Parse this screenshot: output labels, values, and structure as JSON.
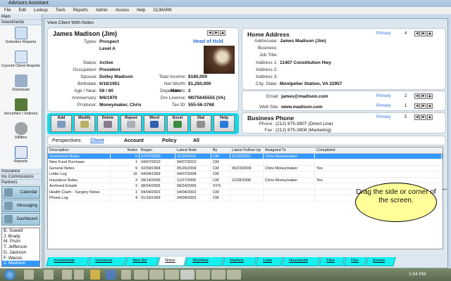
{
  "app": {
    "title": "Advisors Assistant"
  },
  "menu": [
    "File",
    "Edit",
    "Lookup",
    "Tools",
    "Reports",
    "Admin",
    "Access",
    "Help",
    "CLIMARK"
  ],
  "sidebar": {
    "main": "Main",
    "investments": "Investments",
    "icons": [
      {
        "label": "Selection Reports",
        "icon": "selection-reports-icon"
      },
      {
        "label": "Current Client Reports",
        "icon": "client-reports-icon"
      },
      {
        "label": "Download",
        "icon": "download-icon"
      },
      {
        "label": "Securities / Indexes",
        "icon": "securities-icon"
      },
      {
        "label": "Utilities",
        "icon": "wrench-icon"
      },
      {
        "label": "Reports",
        "icon": "reports-icon"
      }
    ],
    "insurance": "Insurance",
    "ins_commissions": "Ins Commissions",
    "partners": "Partners",
    "big_buttons": [
      "Calendar",
      "Messaging",
      "Dashboard"
    ],
    "partner_list": [
      "B. Sowell",
      "J. Brady",
      "M. Pozo",
      "T. Jefferson",
      "D. Jackson",
      "F. Wacos",
      "J. Madison"
    ],
    "selected_partner": "J. Madison"
  },
  "window": {
    "title": "View Client With Notes"
  },
  "client": {
    "name": "James Madison (Jim)",
    "head_of_hsld": "Head of Hsld",
    "types_label": "Types:",
    "types": "Prospect",
    "level": "Level A",
    "fields_left": [
      {
        "label": "Status:",
        "value": "Active"
      },
      {
        "label": "Occupation:",
        "value": "President"
      },
      {
        "label": "Spouse:",
        "value": "Dolley Madison"
      },
      {
        "label": "Birthdate:",
        "value": "6/16/1951"
      },
      {
        "label": "Age / Near:",
        "value": "59 / 60"
      },
      {
        "label": "Anniversary:",
        "value": "9/6/1970"
      },
      {
        "label": "Producer:",
        "value": "Moneymaker, Chris"
      }
    ],
    "gender": "Male",
    "fields_right": [
      {
        "label": "Total Income:",
        "value": "$180,000"
      },
      {
        "label": "Net Worth:",
        "value": "$1,250,000"
      },
      {
        "label": "Dependents:",
        "value": "2"
      },
      {
        "label": "Drv License:",
        "value": "M075645555 (VA)"
      },
      {
        "label": "Tax ID:",
        "value": "555-56-3768"
      }
    ]
  },
  "address": {
    "title": "Home Address",
    "primary": "Primary",
    "count": "4",
    "fields": [
      {
        "label": "Addressee:",
        "value": "James Madison (Jim)"
      },
      {
        "label": "Business:",
        "value": ""
      },
      {
        "label": "Job Title:",
        "value": ""
      },
      {
        "label": "Address 1:",
        "value": "11407 Constitution Hwy"
      },
      {
        "label": "Address 2:",
        "value": ""
      },
      {
        "label": "Address 3:",
        "value": ""
      },
      {
        "label": "City, State:",
        "value": "Montpelier Station,   VA   22957"
      }
    ]
  },
  "contact": {
    "email_label": "Email:",
    "email": "james@madison.com",
    "email_primary": "Primary",
    "email_count": "2",
    "web_label": "Web Site:",
    "web": "www.madison.com",
    "web_primary": "Primary",
    "web_count": "1"
  },
  "phone": {
    "title": "Business Phone",
    "primary": "Primary",
    "count": "5",
    "phone_label": "Phone:",
    "phone": "(212) 875-3907  (Direct Line)",
    "fax_label": "Fax:",
    "fax": "(212) 875-3908  (Marketing)"
  },
  "toolbar": [
    {
      "label": "Add",
      "color": "#7c9cc0"
    },
    {
      "label": "Modify",
      "color": "#b8b060"
    },
    {
      "label": "Delete",
      "color": "#8a7a90"
    },
    {
      "label": "Report",
      "color": "#aab0b8"
    },
    {
      "label": "Word",
      "color": "#3060b0"
    },
    {
      "label": "Excel",
      "color": "#3a8a40"
    },
    {
      "label": "Dial",
      "color": "#909090"
    },
    {
      "label": "Help",
      "color": "#2a7ad8"
    }
  ],
  "perspectives": {
    "label": "Perspectives:",
    "options": [
      "Client",
      "Account",
      "Policy",
      "All"
    ],
    "active": "Client"
  },
  "table": {
    "headers": [
      "Description",
      "Notes",
      "Began",
      "Latest Note",
      "By",
      "Latest Follow-Up",
      "Assigned To",
      "Completed"
    ],
    "rows": [
      [
        "Investment Notes",
        "5",
        "07/07/2000",
        "01/24/2011",
        "CM",
        "01/30/2011",
        "Chris Moneymaker",
        ""
      ],
      [
        "New Fund Purchase",
        "1",
        "04/07/2010",
        "04/07/2010",
        "CM",
        "",
        "",
        ""
      ],
      [
        "General Notes",
        "9",
        "02/09/1994",
        "05/26/2009",
        "CM",
        "06/23/2009",
        "Chris Moneymaker",
        "Yes"
      ],
      [
        "Letter Log",
        "16",
        "04/04/1999",
        "04/07/2008",
        "CM",
        "",
        "",
        ""
      ],
      [
        "Insurance Notes",
        "3",
        "09/14/2006",
        "11/27/2006",
        "CM",
        "11/28/2006",
        "Chris Moneymaker",
        "Yes"
      ],
      [
        "Archived Emails",
        "2",
        "08/24/2006",
        "08/24/2006",
        "SYS",
        "",
        "",
        ""
      ],
      [
        "Health Claim - Surgery Notes",
        "1",
        "04/04/2002",
        "04/04/2002",
        "CM",
        "",
        "",
        ""
      ],
      [
        "Phone Log",
        "4",
        "01/16/1999",
        "04/04/2002",
        "CM",
        "",
        "",
        ""
      ]
    ]
  },
  "tabs": [
    "Investments",
    "Insurance",
    "New Biz",
    "Notes",
    "Workflow",
    "Markets",
    "Links",
    "Household",
    "Files",
    "Flex",
    "Events"
  ],
  "active_tab": "Notes",
  "callout": "Drag the side or corner of the screen.",
  "taskbar": {
    "clock": "1:54 PM"
  },
  "colors": {
    "accent": "#18d8e8",
    "selection": "#3399ff",
    "link": "#2a6fdc"
  }
}
